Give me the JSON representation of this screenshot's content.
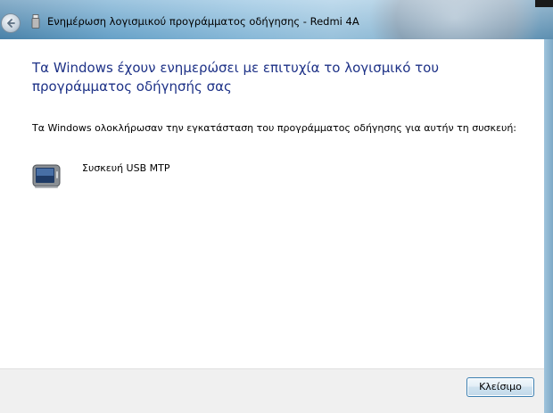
{
  "window": {
    "title": "Ενημέρωση λογισμικού προγράμματος οδήγησης - Redmi 4A"
  },
  "icons": {
    "back": "back-arrow-icon",
    "usb": "usb-icon",
    "device": "portable-device-icon"
  },
  "content": {
    "heading": "Τα Windows έχουν ενημερώσει με επιτυχία το λογισμικό του προγράμματος οδήγησής σας",
    "info": "Τα Windows ολοκλήρωσαν την εγκατάσταση του προγράμματος οδήγησης για αυτήν τη συσκευή:",
    "device_name": "Συσκευή USB MTP"
  },
  "footer": {
    "close_label": "Κλείσιμο"
  },
  "colors": {
    "heading": "#1e3287",
    "button_border": "#3c7fb1",
    "footer_bg": "#f0f0f0"
  }
}
